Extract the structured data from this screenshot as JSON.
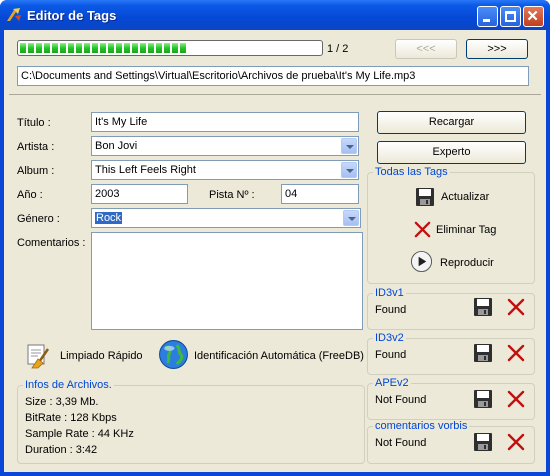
{
  "window": {
    "title": "Editor de Tags"
  },
  "progress": {
    "value": 0.55,
    "counter": "1 / 2"
  },
  "nav": {
    "prev_label": "<<<",
    "next_label": ">>>"
  },
  "path": {
    "value": "C:\\Documents and Settings\\Virtual\\Escritorio\\Archivos de prueba\\It's My Life.mp3"
  },
  "form": {
    "title_label": "Título :",
    "title_value": "It's My Life",
    "artist_label": "Artista :",
    "artist_value": "Bon Jovi",
    "album_label": "Album :",
    "album_value": "This Left Feels Right",
    "year_label": "Año :",
    "year_value": "2003",
    "track_label": "Pista Nº :",
    "track_value": "04",
    "genre_label": "Género :",
    "genre_value": "Rock",
    "comments_label": "Comentarios :"
  },
  "actions": {
    "reload_label": "Recargar",
    "expert_label": "Experto"
  },
  "all_tags": {
    "title": "Todas las Tags",
    "update_label": "Actualizar",
    "delete_label": "Eliminar Tag",
    "play_label": "Reproducir"
  },
  "tools": {
    "clean_label": "Limpiado Rápido",
    "freedb_label": "Identificación Automática (FreeDB)"
  },
  "file_info": {
    "title": "Infos de Archivos.",
    "size": "Size : 3,39 Mb.",
    "bitrate": "BitRate : 128 Kbps",
    "sample_rate": "Sample Rate : 44 KHz",
    "duration": "Duration : 3:42"
  },
  "tags": [
    {
      "name": "ID3v1",
      "status": "Found"
    },
    {
      "name": "ID3v2",
      "status": "Found"
    },
    {
      "name": "APEv2",
      "status": "Not Found"
    },
    {
      "name": "comentarios vorbis",
      "status": "Not Found"
    }
  ],
  "colors": {
    "accent": "#0046d5",
    "delete": "#c01010",
    "progress": "#27c427"
  }
}
